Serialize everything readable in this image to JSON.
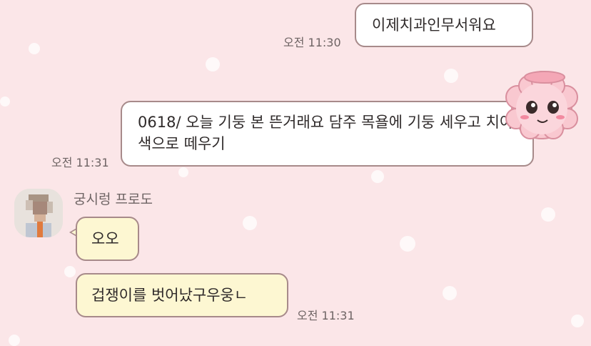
{
  "messages_sent": [
    {
      "text": "이제치과인무서워요",
      "time": "오전 11:30"
    },
    {
      "text": "0618/ 오늘 기둥 본 뜬거래요 담주 목욜에 기둥 세우고 치아색으로 떼우기",
      "time": "오전 11:31"
    }
  ],
  "received": {
    "sender_name": "궁시렁 프로도",
    "messages": [
      {
        "text": "오오"
      },
      {
        "text": "겁쟁이를 벗어났구우웅ㄴ",
        "time": "오전 11:31"
      }
    ]
  },
  "colors": {
    "background": "#fbe6e8",
    "sent_bubble": "#ffffff",
    "received_bubble": "#fdf7d2",
    "bubble_border": "#a78a8a"
  },
  "icons": [
    "esther-bunny-sticker",
    "avatar-pixelated"
  ]
}
